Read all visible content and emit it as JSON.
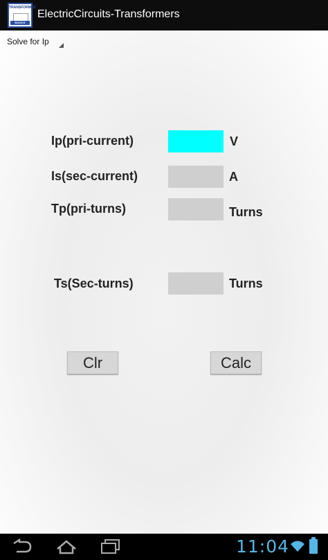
{
  "titlebar": {
    "app_title": "ElectricCircuits-Transformers",
    "icon_text_top": "TRANSFORMER",
    "icon_text_bottom": "BASICS"
  },
  "spinner": {
    "selected": "Solve for Ip"
  },
  "rows": [
    {
      "label": "Ip(pri-current)",
      "unit": "V",
      "value": "",
      "active": true
    },
    {
      "label": "Is(sec-current)",
      "unit": "A",
      "value": "",
      "active": false
    },
    {
      "label": "Tp(pri-turns)",
      "unit": "Turns",
      "value": "",
      "active": false
    },
    {
      "label": "Ts(Sec-turns)",
      "unit": "Turns",
      "value": "",
      "active": false
    }
  ],
  "buttons": {
    "clear_label": "Clr",
    "calc_label": "Calc"
  },
  "statusbar": {
    "time": "11:04"
  },
  "colors": {
    "active_field": "#00ffff",
    "field": "#cfcfcf",
    "clock": "#53b7e6"
  }
}
